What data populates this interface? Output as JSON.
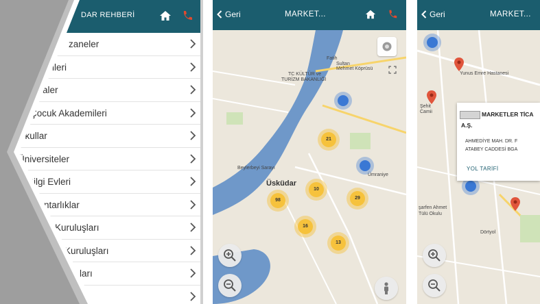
{
  "directory": {
    "title": "DAR REHBERİ",
    "items": [
      {
        "label": "zaneler"
      },
      {
        "label": "lleri"
      },
      {
        "label": "aler"
      },
      {
        "label": "Çocuk Akademileri"
      },
      {
        "label": "Okullar"
      },
      {
        "label": "Üniversiteler"
      },
      {
        "label": "Bilgi Evleri"
      },
      {
        "label": "ntarlıklar"
      },
      {
        "label": "Kuruluşları"
      },
      {
        "label": "Kuruluşları"
      },
      {
        "label": "ları"
      },
      {
        "label": ""
      }
    ]
  },
  "map_screen": {
    "back_label": "Geri",
    "title": "MARKET...",
    "labels": {
      "sultan": "Sultan",
      "mehmet": "Mehmet Köprüsü",
      "fatih": "Fatih",
      "tc_kultur": "TC KÜLTÜR ve",
      "turizm": "TURİZM BAKANLIĞI",
      "beylerbeyi": "Beylerbeyi Sarayı",
      "uskudar": "Üsküdar",
      "umraniye": "Ümraniye"
    },
    "clusters": [
      "21",
      "10",
      "98",
      "29",
      "16",
      "13"
    ]
  },
  "detail_screen": {
    "back_label": "Geri",
    "title": "MARKET...",
    "labels": {
      "hastanesi": "Yunus Emre Hastanesi",
      "camii": "Camii",
      "sehit": "Şehit",
      "ahmet": "şarfen Ahmet",
      "okul": "Tülü Okulu",
      "dortyol": "Dörtyol"
    },
    "info": {
      "name_line1": "MARKETLER TİCA",
      "name_line2": "A.Ş.",
      "address_line1": "AHMEDİYE MAH. DR. F",
      "address_line2": "ATABEY CADDESİ BGA",
      "route_label": "YOL TARİFİ"
    }
  },
  "colors": {
    "header": "#1b5d6e",
    "phone_icon": "#e04a2f",
    "cluster": "#f6c23c",
    "water": "#6f98c9",
    "pin": "#e0553c"
  }
}
